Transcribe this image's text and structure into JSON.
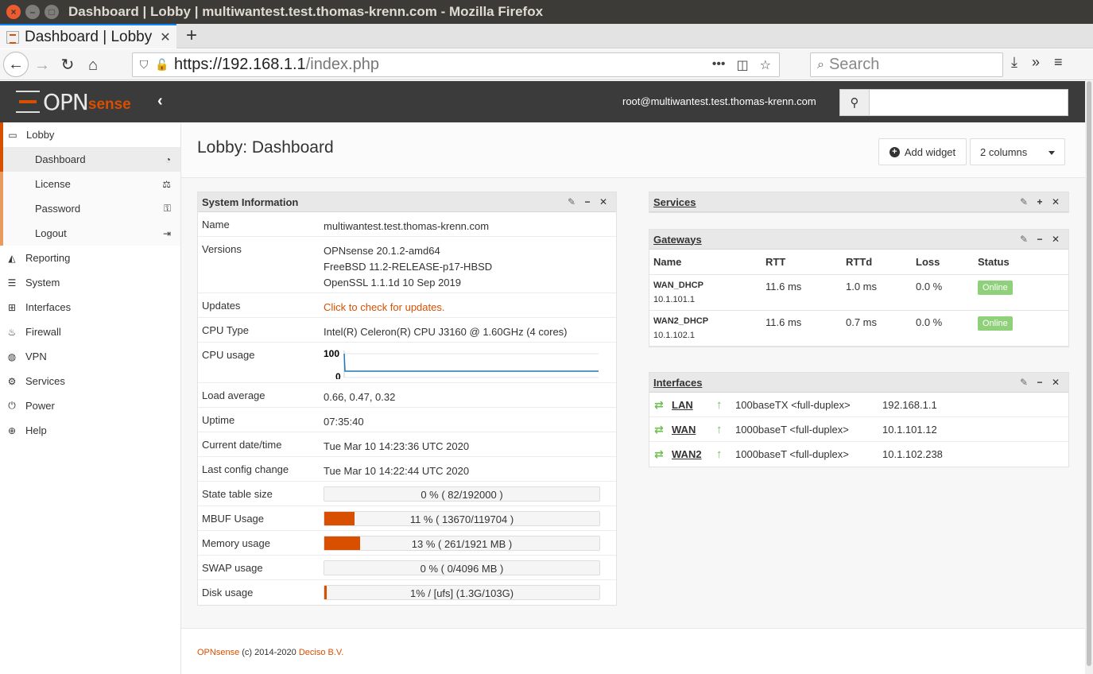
{
  "window": {
    "title": "Dashboard | Lobby | multiwantest.test.thomas-krenn.com - Mozilla Firefox"
  },
  "browser": {
    "tab_title": "Dashboard | Lobby",
    "url_host": "https://192.168.1.1",
    "url_path": "/index.php",
    "search_placeholder": "Search"
  },
  "app": {
    "logo_opn": "OPN",
    "logo_sense": "sense",
    "user": "root@multiwantest.test.thomas-krenn.com"
  },
  "sidebar": {
    "lobby": "Lobby",
    "lobby_items": [
      {
        "label": "Dashboard",
        "icon": "dashboard-icon"
      },
      {
        "label": "License",
        "icon": "scale-icon"
      },
      {
        "label": "Password",
        "icon": "key-icon"
      },
      {
        "label": "Logout",
        "icon": "sign-out-icon"
      }
    ],
    "items": [
      {
        "label": "Reporting",
        "icon": "area-chart-icon"
      },
      {
        "label": "System",
        "icon": "server-icon"
      },
      {
        "label": "Interfaces",
        "icon": "sitemap-icon"
      },
      {
        "label": "Firewall",
        "icon": "fire-icon"
      },
      {
        "label": "VPN",
        "icon": "globe-icon"
      },
      {
        "label": "Services",
        "icon": "cog-icon"
      },
      {
        "label": "Power",
        "icon": "plug-icon"
      },
      {
        "label": "Help",
        "icon": "life-ring-icon"
      }
    ]
  },
  "page": {
    "title": "Lobby: Dashboard",
    "add_widget": "Add widget",
    "columns": "2 columns"
  },
  "sysinfo": {
    "title": "System Information",
    "rows": {
      "name_k": "Name",
      "name_v": "multiwantest.test.thomas-krenn.com",
      "versions_k": "Versions",
      "version1": "OPNsense 20.1.2-amd64",
      "version2": "FreeBSD 11.2-RELEASE-p17-HBSD",
      "version3": "OpenSSL 1.1.1d 10 Sep 2019",
      "updates_k": "Updates",
      "updates_v": "Click to check for updates.",
      "cputype_k": "CPU Type",
      "cputype_v": "Intel(R) Celeron(R) CPU J3160 @ 1.60GHz (4 cores)",
      "cpuusage_k": "CPU usage",
      "cpu_max": "100",
      "cpu_min": "0",
      "load_k": "Load average",
      "load_v": "0.66, 0.47, 0.32",
      "uptime_k": "Uptime",
      "uptime_v": "07:35:40",
      "date_k": "Current date/time",
      "date_v": "Tue Mar 10 14:23:36 UTC 2020",
      "config_k": "Last config change",
      "config_v": "Tue Mar 10 14:22:44 UTC 2020"
    },
    "bars": [
      {
        "label": "State table size",
        "text": "0 % ( 82/192000 )",
        "pct": 0
      },
      {
        "label": "MBUF Usage",
        "text": "11 % ( 13670/119704 )",
        "pct": 11
      },
      {
        "label": "Memory usage",
        "text": "13 % ( 261/1921 MB )",
        "pct": 13
      },
      {
        "label": "SWAP usage",
        "text": "0 % ( 0/4096 MB )",
        "pct": 0
      },
      {
        "label": "Disk usage",
        "text": "1% / [ufs] (1.3G/103G)",
        "pct": 1
      }
    ]
  },
  "services": {
    "title": "Services"
  },
  "gateways": {
    "title": "Gateways",
    "headers": [
      "Name",
      "RTT",
      "RTTd",
      "Loss",
      "Status"
    ],
    "rows": [
      {
        "name": "WAN_DHCP",
        "addr": "10.1.101.1",
        "rtt": "11.6 ms",
        "rttd": "1.0 ms",
        "loss": "0.0 %",
        "status": "Online"
      },
      {
        "name": "WAN2_DHCP",
        "addr": "10.1.102.1",
        "rtt": "11.6 ms",
        "rttd": "0.7 ms",
        "loss": "0.0 %",
        "status": "Online"
      }
    ]
  },
  "interfaces": {
    "title": "Interfaces",
    "rows": [
      {
        "name": "LAN",
        "media": "100baseTX <full-duplex>",
        "ip": "192.168.1.1"
      },
      {
        "name": "WAN",
        "media": "1000baseT <full-duplex>",
        "ip": "10.1.101.12"
      },
      {
        "name": "WAN2",
        "media": "1000baseT <full-duplex>",
        "ip": "10.1.102.238"
      }
    ]
  },
  "footer": {
    "brand": "OPNsense",
    "copy": " (c) 2014-2020 ",
    "company": "Deciso B.V."
  },
  "colors": {
    "accent": "#d94f00",
    "online": "#8fd17a",
    "topbar": "#3b3b3b"
  }
}
